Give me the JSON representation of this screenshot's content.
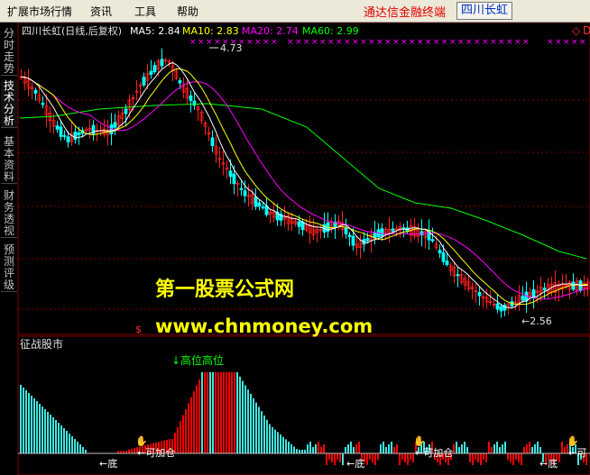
{
  "menu": {
    "items": [
      "扩展市场行情",
      "资讯",
      "工具",
      "帮助"
    ],
    "brand": "通达信金融终端",
    "stock_tag": "四川长虹"
  },
  "sidebar": {
    "tabs": [
      "分时走势",
      "技术分析",
      "基本资料",
      "财务透视",
      "预测评级"
    ],
    "active": "技术分析"
  },
  "main_chart": {
    "title": "四川长虹(日线,后复权)",
    "ma": [
      {
        "label": "MA5: 2.84",
        "color": "#ffffff"
      },
      {
        "label": "MA10: 2.83",
        "color": "#ffff00"
      },
      {
        "label": "MA20: 2.74",
        "color": "#ff00ff"
      },
      {
        "label": "MA60: 2.99",
        "color": "#00ff00"
      }
    ],
    "high_label": "4.73",
    "low_label": "←2.56",
    "sign_marker": "$"
  },
  "watermark": {
    "line1": "第一股票公式网",
    "line2": "www.chnmoney.com"
  },
  "indicator": {
    "title": "征战股市",
    "high_label": "↓高位高位",
    "signals": [
      "←底",
      "←可加仓",
      "←底",
      "←可加仓",
      "←底",
      "←可"
    ]
  },
  "colors": {
    "bull": "#ff2020",
    "bear": "#00ffff",
    "ma5": "#ffffff",
    "ma10": "#ffff00",
    "ma20": "#ff00ff",
    "ma60": "#00ff00",
    "indicator_red": "#ff0000",
    "indicator_cyan": "#3ee8e0",
    "grid": "#800000"
  }
}
